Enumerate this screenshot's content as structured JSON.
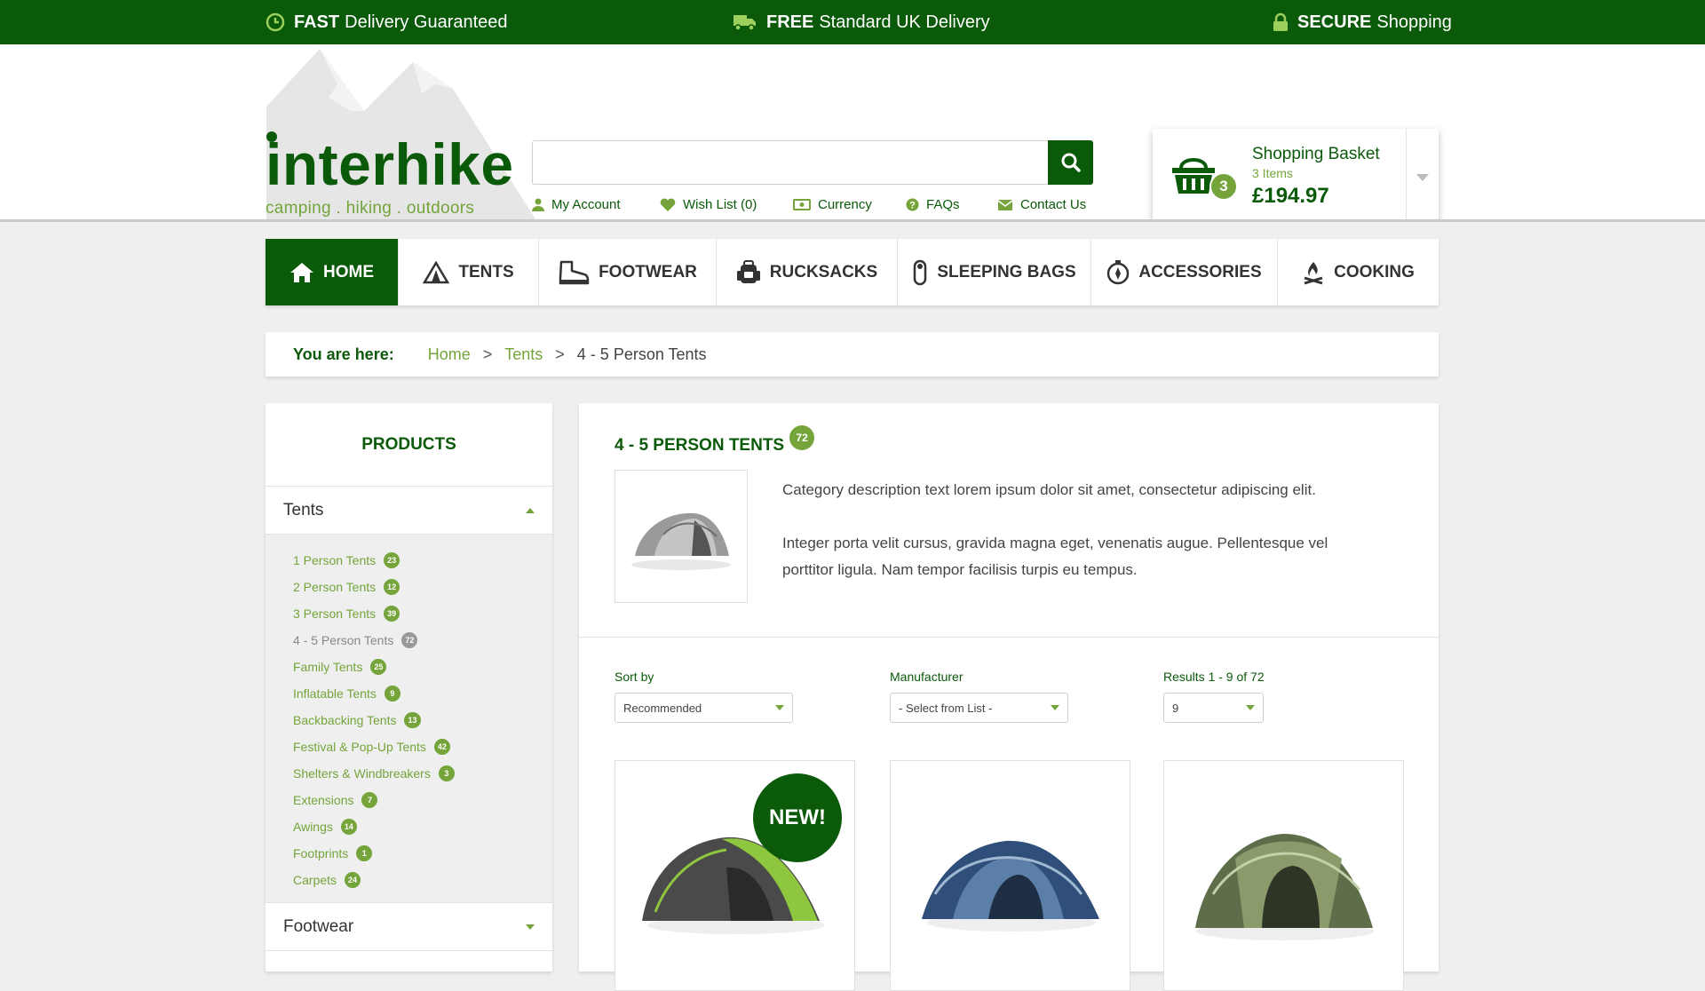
{
  "topbar": {
    "fast_bold": "FAST",
    "fast_rest": "Delivery Guaranteed",
    "free_bold": "FREE",
    "free_rest": "Standard UK Delivery",
    "secure_bold": "SECURE",
    "secure_rest": "Shopping"
  },
  "logo": {
    "first_letter": "i",
    "rest": "nterhike",
    "tagline": "camping . hiking . outdoors"
  },
  "search": {
    "value": "",
    "placeholder": ""
  },
  "toplinks": {
    "account": "My Account",
    "wishlist": "Wish List (0)",
    "currency": "Currency",
    "faqs": "FAQs",
    "contact": "Contact Us"
  },
  "basket": {
    "title": "Shopping Basket",
    "items": "3 Items",
    "count": "3",
    "total": "£194.97"
  },
  "nav": {
    "home": "HOME",
    "tents": "TENTS",
    "footwear": "FOOTWEAR",
    "rucksacks": "RUCKSACKS",
    "sleeping_bags": "SLEEPING BAGS",
    "accessories": "ACCESSORIES",
    "cooking": "COOKING"
  },
  "breadcrumb": {
    "label": "You are here:",
    "home": "Home",
    "tents": "Tents",
    "current": "4 - 5 Person Tents",
    "sep": ">"
  },
  "sidebar": {
    "title": "PRODUCTS",
    "section_tents": "Tents",
    "section_footwear": "Footwear",
    "items": [
      {
        "label": "1 Person Tents",
        "count": "23"
      },
      {
        "label": "2 Person Tents",
        "count": "12"
      },
      {
        "label": "3 Person Tents",
        "count": "39"
      },
      {
        "label": "4 - 5 Person Tents",
        "count": "72"
      },
      {
        "label": "Family Tents",
        "count": "25"
      },
      {
        "label": "Inflatable Tents",
        "count": "9"
      },
      {
        "label": "Backbacking Tents",
        "count": "13"
      },
      {
        "label": "Festival & Pop-Up Tents",
        "count": "42"
      },
      {
        "label": "Shelters & Windbreakers",
        "count": "3"
      },
      {
        "label": "Extensions",
        "count": "7"
      },
      {
        "label": "Awings",
        "count": "14"
      },
      {
        "label": "Footprints",
        "count": "1"
      },
      {
        "label": "Carpets",
        "count": "24"
      }
    ]
  },
  "category": {
    "title": "4 - 5 PERSON TENTS",
    "count": "72",
    "desc1": "Category description text lorem ipsum dolor sit amet, consectetur adipiscing elit.",
    "desc2": "Integer porta velit cursus, gravida magna eget, venenatis augue. Pellentesque vel porttitor ligula.  Nam tempor facilisis turpis eu tempus."
  },
  "filters": {
    "sort_label": "Sort by",
    "sort_value": "Recommended",
    "manufacturer_label": "Manufacturer",
    "manufacturer_value": "- Select from List -",
    "results_label": "Results 1 - 9 of 72",
    "results_value": "9"
  },
  "products": {
    "new_badge": "NEW!"
  },
  "colors": {
    "brand_dark": "#0a5a0a",
    "brand_light": "#74a43a"
  }
}
